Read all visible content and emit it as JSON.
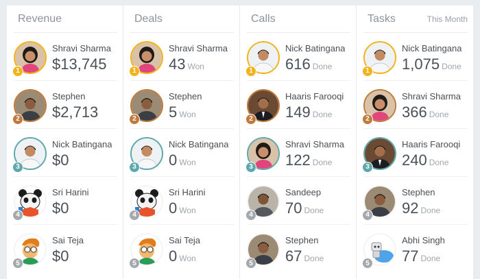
{
  "columns": [
    {
      "title": "Revenue",
      "extra": "",
      "rows": [
        {
          "rank": "1",
          "name": "Shravi Sharma",
          "value": "$13,745",
          "unit": "",
          "avatar": "woman"
        },
        {
          "rank": "2",
          "name": "Stephen",
          "value": "$2,713",
          "unit": "",
          "avatar": "man"
        },
        {
          "rank": "3",
          "name": "Nick Batingana",
          "value": "$0",
          "unit": "",
          "avatar": "man-light"
        },
        {
          "rank": "4",
          "name": "Sri Harini",
          "value": "$0",
          "unit": "",
          "avatar": "panda"
        },
        {
          "rank": "5",
          "name": "Sai Teja",
          "value": "$0",
          "unit": "",
          "avatar": "cartoon"
        }
      ]
    },
    {
      "title": "Deals",
      "extra": "",
      "rows": [
        {
          "rank": "1",
          "name": "Shravi Sharma",
          "value": "43",
          "unit": "Won",
          "avatar": "woman"
        },
        {
          "rank": "2",
          "name": "Stephen",
          "value": "5",
          "unit": "Won",
          "avatar": "man"
        },
        {
          "rank": "3",
          "name": "Nick Batingana",
          "value": "0",
          "unit": "Won",
          "avatar": "man-light"
        },
        {
          "rank": "4",
          "name": "Sri Harini",
          "value": "0",
          "unit": "Won",
          "avatar": "panda"
        },
        {
          "rank": "5",
          "name": "Sai Teja",
          "value": "0",
          "unit": "Won",
          "avatar": "cartoon"
        }
      ]
    },
    {
      "title": "Calls",
      "extra": "",
      "rows": [
        {
          "rank": "1",
          "name": "Nick Batingana",
          "value": "616",
          "unit": "Done",
          "avatar": "man-light"
        },
        {
          "rank": "2",
          "name": "Haaris Farooqi",
          "value": "149",
          "unit": "Done",
          "avatar": "man-suit"
        },
        {
          "rank": "3",
          "name": "Shravi Sharma",
          "value": "122",
          "unit": "Done",
          "avatar": "woman"
        },
        {
          "rank": "4",
          "name": "Sandeep",
          "value": "70",
          "unit": "Done",
          "avatar": "man-dark"
        },
        {
          "rank": "5",
          "name": "Stephen",
          "value": "67",
          "unit": "Done",
          "avatar": "man"
        }
      ]
    },
    {
      "title": "Tasks",
      "extra": "This Month",
      "rows": [
        {
          "rank": "1",
          "name": "Nick Batingana",
          "value": "1,075",
          "unit": "Done",
          "avatar": "man-light"
        },
        {
          "rank": "2",
          "name": "Shravi Sharma",
          "value": "366",
          "unit": "Done",
          "avatar": "woman"
        },
        {
          "rank": "3",
          "name": "Haaris Farooqi",
          "value": "240",
          "unit": "Done",
          "avatar": "man-suit"
        },
        {
          "rank": "4",
          "name": "Stephen",
          "value": "92",
          "unit": "Done",
          "avatar": "man"
        },
        {
          "rank": "5",
          "name": "Abhi Singh",
          "value": "77",
          "unit": "Done",
          "avatar": "robot-cloud"
        }
      ]
    }
  ]
}
